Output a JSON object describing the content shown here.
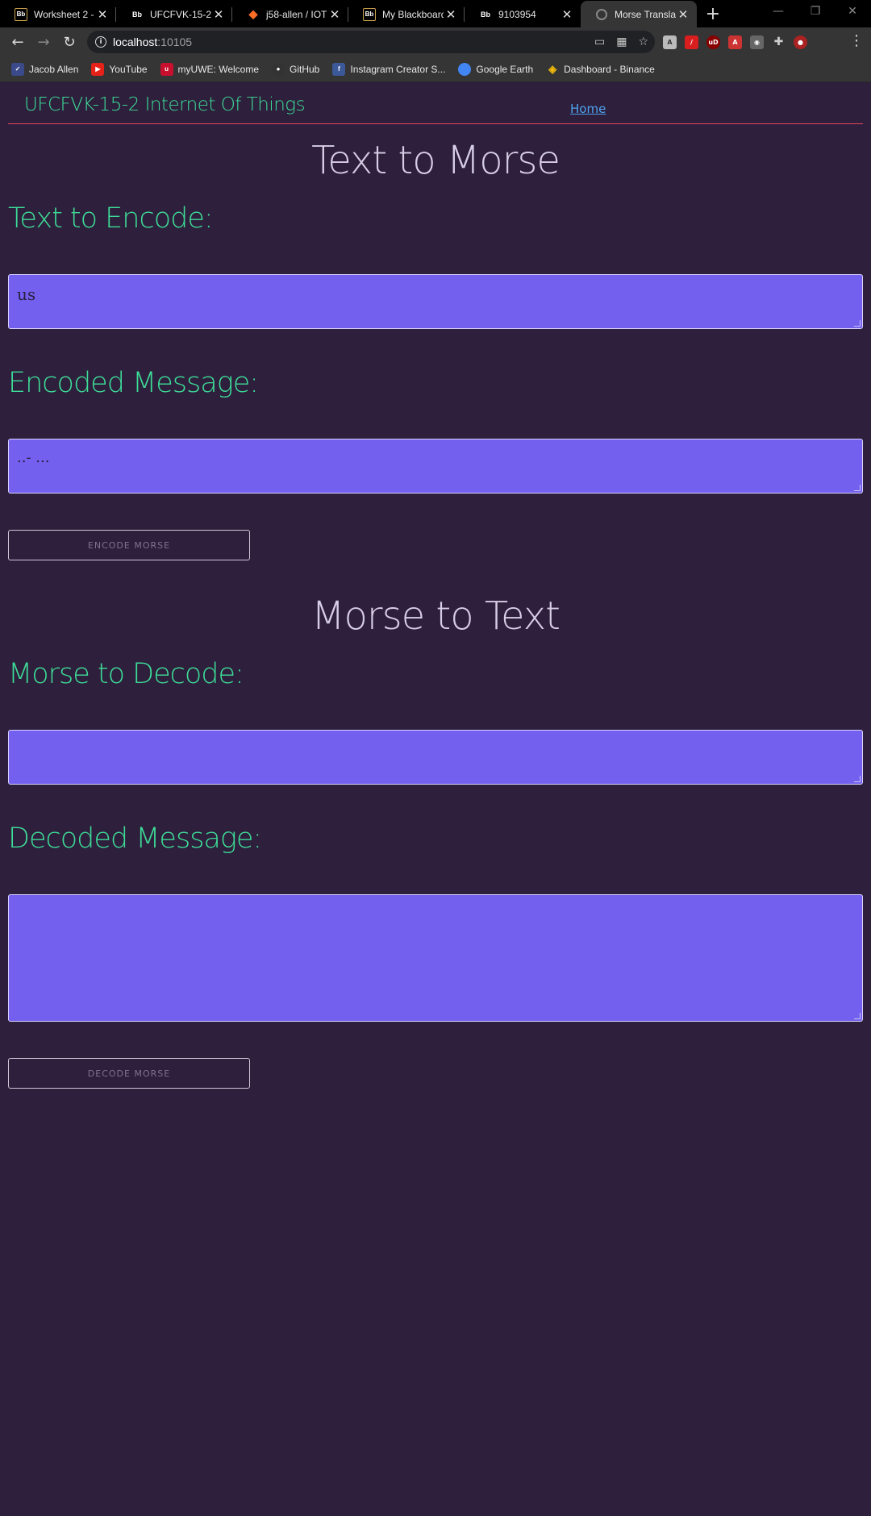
{
  "browser": {
    "tabs": [
      {
        "label": "Worksheet 2 -",
        "favicon": "bb-icon"
      },
      {
        "label": "UFCFVK-15-2 I",
        "favicon": "bb-icon"
      },
      {
        "label": "j58-allen / IOT",
        "favicon": "gitlab-icon"
      },
      {
        "label": "My Blackboard",
        "favicon": "bb-icon"
      },
      {
        "label": "9103954",
        "favicon": "bb-icon"
      },
      {
        "label": "Morse Translat",
        "favicon": "globe-icon"
      }
    ],
    "active_tab_index": 5,
    "address": {
      "host": "localhost",
      "port": ":10105"
    },
    "bookmarks": [
      {
        "label": "Jacob Allen",
        "color": "#3a4a8a"
      },
      {
        "label": "YouTube",
        "color": "#e62117"
      },
      {
        "label": "myUWE: Welcome",
        "color": "#c8102e"
      },
      {
        "label": "GitHub",
        "color": "#333333"
      },
      {
        "label": "Instagram Creator S...",
        "color": "#3b5998"
      },
      {
        "label": "Google Earth",
        "color": "#4285f4"
      },
      {
        "label": "Dashboard - Binance",
        "color": "#f0b90b"
      }
    ]
  },
  "site": {
    "brand": "UFCFVK-15-2 Internet Of Things",
    "nav_home": "Home"
  },
  "encode": {
    "heading": "Text to Morse",
    "input_label": "Text to Encode:",
    "input_value": "us",
    "output_label": "Encoded Message:",
    "output_value": "..- ...",
    "button_label": "ENCODE MORSE"
  },
  "decode": {
    "heading": "Morse to Text",
    "input_label": "Morse to Decode:",
    "input_value": "",
    "output_label": "Decoded Message:",
    "output_value": "",
    "button_label": "DECODE MORSE"
  },
  "colors": {
    "background": "#2e1f3c",
    "accent_green": "#3ddc97",
    "field_purple": "#7360ee",
    "divider_red": "#e0475a"
  }
}
